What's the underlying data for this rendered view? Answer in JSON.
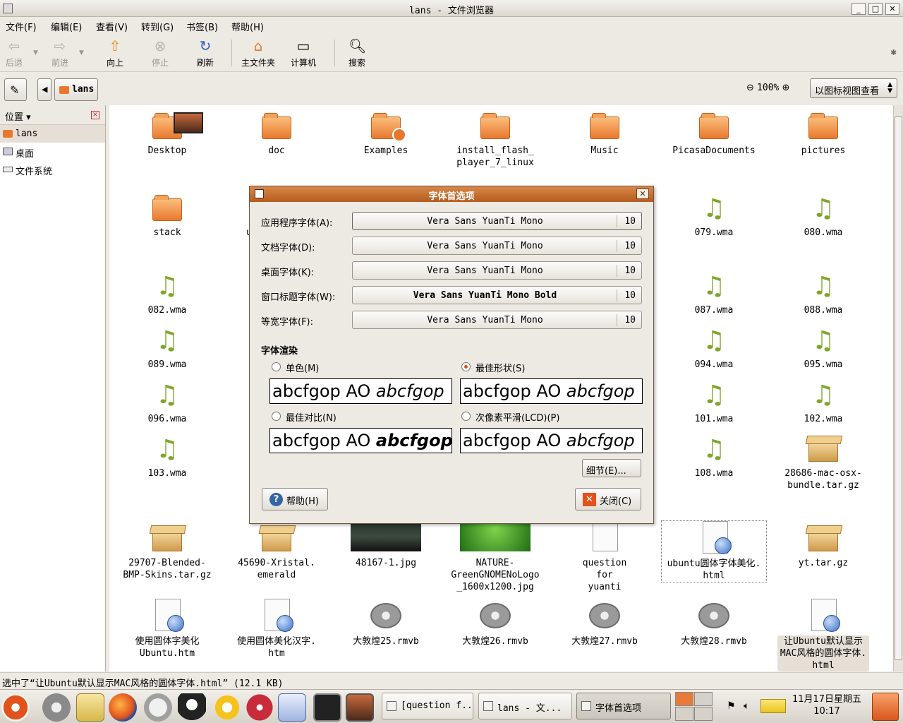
{
  "window": {
    "title": "lans - 文件浏览器"
  },
  "menu": [
    "文件(F)",
    "编辑(E)",
    "查看(V)",
    "转到(G)",
    "书签(B)",
    "帮助(H)"
  ],
  "toolbar": {
    "back": "后退",
    "forward": "前进",
    "up": "向上",
    "stop": "停止",
    "reload": "刷新",
    "home": "主文件夹",
    "computer": "计算机",
    "search": "搜索"
  },
  "location": {
    "path_button": "lans",
    "zoom": "100%",
    "view_mode": "以图标视图查看"
  },
  "sidebar": {
    "header": "位置",
    "items": [
      "lans",
      "桌面",
      "文件系统"
    ]
  },
  "files": [
    {
      "name": "Desktop",
      "type": "folder"
    },
    {
      "name": "doc",
      "type": "folder"
    },
    {
      "name": "Examples",
      "type": "folder-link"
    },
    {
      "name": "install_flash_ player_7_linux",
      "type": "folder"
    },
    {
      "name": "Music",
      "type": "folder"
    },
    {
      "name": "PicasaDocuments",
      "type": "folder"
    },
    {
      "name": "pictures",
      "type": "folder"
    },
    {
      "name": "stack",
      "type": "folder"
    },
    {
      "name": "ubun",
      "type": "folder"
    },
    {
      "name": "079.wma",
      "type": "audio"
    },
    {
      "name": "080.wma",
      "type": "audio"
    },
    {
      "name": "082.wma",
      "type": "audio"
    },
    {
      "name": "087.wma",
      "type": "audio"
    },
    {
      "name": "088.wma",
      "type": "audio"
    },
    {
      "name": "089.wma",
      "type": "audio"
    },
    {
      "name": "094.wma",
      "type": "audio"
    },
    {
      "name": "095.wma",
      "type": "audio"
    },
    {
      "name": "096.wma",
      "type": "audio"
    },
    {
      "name": "101.wma",
      "type": "audio"
    },
    {
      "name": "102.wma",
      "type": "audio"
    },
    {
      "name": "103.wma",
      "type": "audio"
    },
    {
      "name": "108.wma",
      "type": "audio"
    },
    {
      "name": "28686-mac-osx- bundle.tar.gz",
      "type": "archive"
    },
    {
      "name": "29707-Blended- BMP-Skins.tar.gz",
      "type": "archive"
    },
    {
      "name": "45690-Xristal. emerald",
      "type": "archive"
    },
    {
      "name": "48167-1.jpg",
      "type": "image-dark"
    },
    {
      "name": "NATURE- GreenGNOMENoLogo _1600x1200.jpg",
      "type": "image-green"
    },
    {
      "name": "question for yuanti",
      "type": "text"
    },
    {
      "name": "ubuntu圆体字体美化. html",
      "type": "html"
    },
    {
      "name": "yt.tar.gz",
      "type": "archive"
    },
    {
      "name": "使用圆体字美化 Ubuntu.htm",
      "type": "html"
    },
    {
      "name": "使用圆体美化汉字. htm",
      "type": "html"
    },
    {
      "name": "大敦煌25.rmvb",
      "type": "video"
    },
    {
      "name": "大敦煌26.rmvb",
      "type": "video"
    },
    {
      "name": "大敦煌27.rmvb",
      "type": "video"
    },
    {
      "name": "大敦煌28.rmvb",
      "type": "video"
    },
    {
      "name": "让Ubuntu默认显示 MAC风格的圆体字体. html",
      "type": "html"
    }
  ],
  "dialog": {
    "title": "字体首选项",
    "rows": [
      {
        "label": "应用程序字体(A):",
        "font": "Vera Sans YuanTi Mono",
        "size": "10"
      },
      {
        "label": "文档字体(D):",
        "font": "Vera Sans YuanTi Mono",
        "size": "10"
      },
      {
        "label": "桌面字体(K):",
        "font": "Vera Sans YuanTi Mono",
        "size": "10"
      },
      {
        "label": "窗口标题字体(W):",
        "font": "Vera Sans YuanTi Mono Bold",
        "size": "10"
      },
      {
        "label": "等宽字体(F):",
        "font": "Vera Sans YuanTi Mono",
        "size": "10"
      }
    ],
    "rendering_title": "字体渲染",
    "options": [
      {
        "label": "单色(M)",
        "checked": false
      },
      {
        "label": "最佳形状(S)",
        "checked": true
      },
      {
        "label": "最佳对比(N)",
        "checked": false
      },
      {
        "label": "次像素平滑(LCD)(P)",
        "checked": false
      }
    ],
    "sample_regular": "abcfgop AO ",
    "sample_italic": "abcfgop",
    "details_button": "细节(E)...",
    "help_button": "帮助(H)",
    "close_button": "关闭(C)"
  },
  "statusbar": "选中了“让Ubuntu默认显示MAC风格的圆体字体.html” (12.1 KB)",
  "taskbar": {
    "tasks": [
      "[question f...",
      "lans - 文...",
      "字体首选项"
    ],
    "clock_date": "11月17日星期五",
    "clock_time": "10:17"
  },
  "colors": {
    "accent": "#d4541c",
    "folder": "#e9782e",
    "dialog_title": "#b55c1e"
  }
}
